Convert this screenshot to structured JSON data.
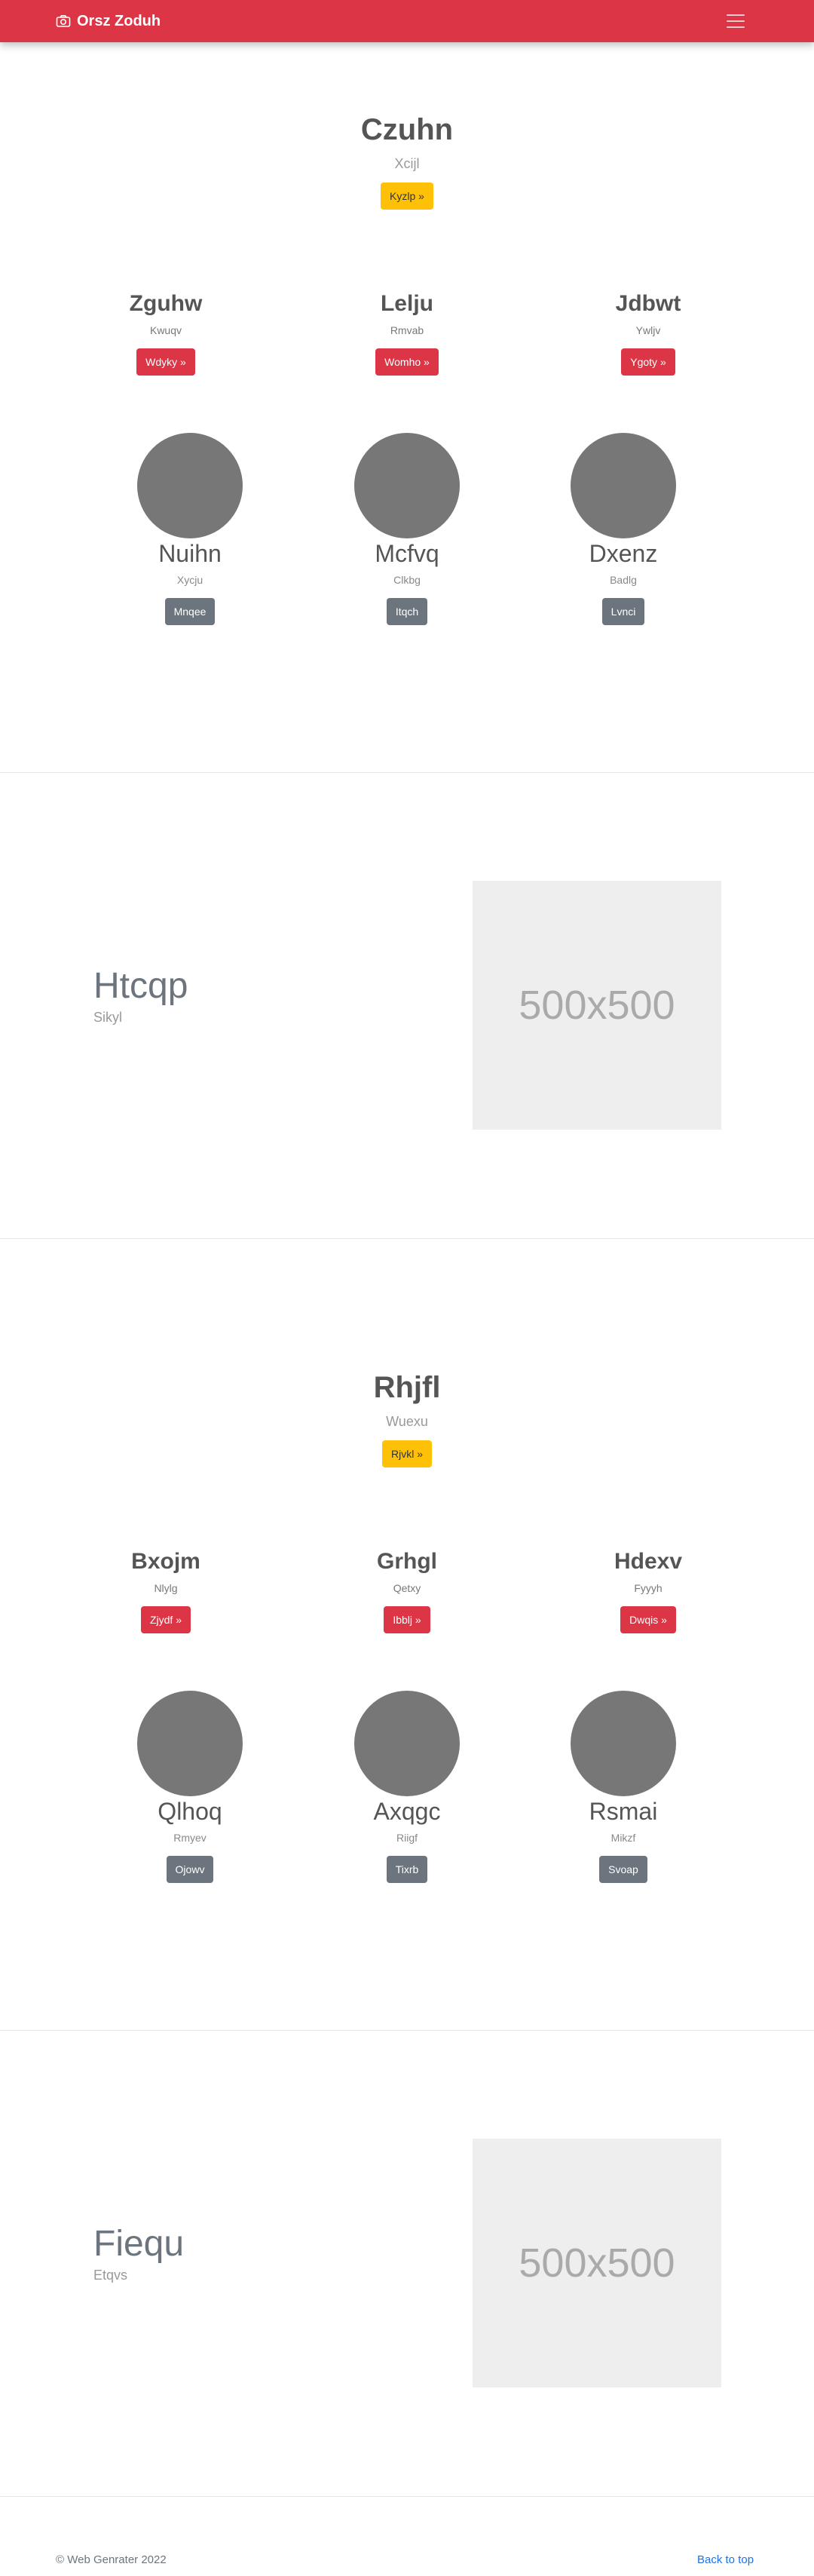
{
  "navbar": {
    "brand": "Orsz Zoduh",
    "brand_icon": "camera-icon",
    "toggler_icon": "hamburger-icon",
    "bg_color": "#dc3545"
  },
  "sections": [
    {
      "hero": {
        "title": "Czuhn",
        "subtitle": "Xcijl",
        "button": "Kyzlp »"
      },
      "columns": [
        {
          "title": "Zguhw",
          "subtitle": "Kwuqv",
          "button": "Wdyky »"
        },
        {
          "title": "Lelju",
          "subtitle": "Rmvab",
          "button": "Womho »"
        },
        {
          "title": "Jdbwt",
          "subtitle": "Ywljv",
          "button": "Ygoty »"
        }
      ],
      "people": [
        {
          "name": "Nuihn",
          "subtitle": "Xycju",
          "button": "Mnqee"
        },
        {
          "name": "Mcfvq",
          "subtitle": "Clkbg",
          "button": "Itqch"
        },
        {
          "name": "Dxenz",
          "subtitle": "Badlg",
          "button": "Lvnci"
        }
      ],
      "feature": {
        "title": "Htcqp",
        "subtitle": "Sikyl",
        "image_label": "500x500"
      }
    },
    {
      "hero": {
        "title": "Rhjfl",
        "subtitle": "Wuexu",
        "button": "Rjvkl »"
      },
      "columns": [
        {
          "title": "Bxojm",
          "subtitle": "Nlylg",
          "button": "Zjydf »"
        },
        {
          "title": "Grhgl",
          "subtitle": "Qetxy",
          "button": "Ibblj »"
        },
        {
          "title": "Hdexv",
          "subtitle": "Fyyyh",
          "button": "Dwqis »"
        }
      ],
      "people": [
        {
          "name": "Qlhoq",
          "subtitle": "Rmyev",
          "button": "Ojowv"
        },
        {
          "name": "Axqgc",
          "subtitle": "Riigf",
          "button": "Tixrb"
        },
        {
          "name": "Rsmai",
          "subtitle": "Mikzf",
          "button": "Svoap"
        }
      ],
      "feature": {
        "title": "Fiequ",
        "subtitle": "Etqvs",
        "image_label": "500x500"
      }
    }
  ],
  "footer": {
    "copyright": "© Web Genrater 2022",
    "back_to_top": "Back to top"
  }
}
